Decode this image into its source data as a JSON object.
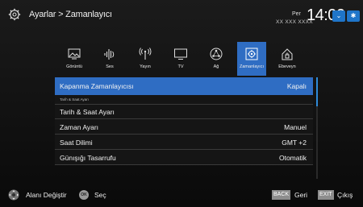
{
  "header": {
    "breadcrumb": "Ayarlar > Zamanlayıcı",
    "day": "Per",
    "date": "XX XXX XXXX",
    "time": "14:00",
    "chips": [
      "⌄",
      "✱"
    ]
  },
  "tabs": [
    {
      "label": "Görüntü",
      "icon": "picture-icon"
    },
    {
      "label": "Ses",
      "icon": "sound-icon"
    },
    {
      "label": "Yayın",
      "icon": "broadcast-icon"
    },
    {
      "label": "TV",
      "icon": "tv-icon"
    },
    {
      "label": "Ağ",
      "icon": "network-icon"
    },
    {
      "label": "Zamanlayıcı",
      "icon": "timer-icon"
    },
    {
      "label": "Ebeveyn",
      "icon": "parental-lock-icon"
    }
  ],
  "active_tab": "Zamanlayıcı",
  "list": {
    "rows": [
      {
        "label": "Kapanma Zamanlayıcısı",
        "value": "Kapalı"
      },
      {
        "label": "Tarih & Saat Ayarı",
        "value": ""
      },
      {
        "label": "Tarih & Saat Ayarı",
        "value": ""
      },
      {
        "label": "Zaman Ayarı",
        "value": "Manuel"
      },
      {
        "label": "Saat Dilimi",
        "value": "GMT +2"
      },
      {
        "label": "Günışığı Tasarrufu",
        "value": "Otomatik"
      }
    ]
  },
  "footer": {
    "move_label": "Alanı Değiştir",
    "ok_key": "OK",
    "select_label": "Seç",
    "back_key": "BACK",
    "back_label": "Geri",
    "exit_key": "EXIT",
    "exit_label": "Çıkış"
  },
  "colors": {
    "accent": "#2f6dc3",
    "background": "#111111"
  }
}
